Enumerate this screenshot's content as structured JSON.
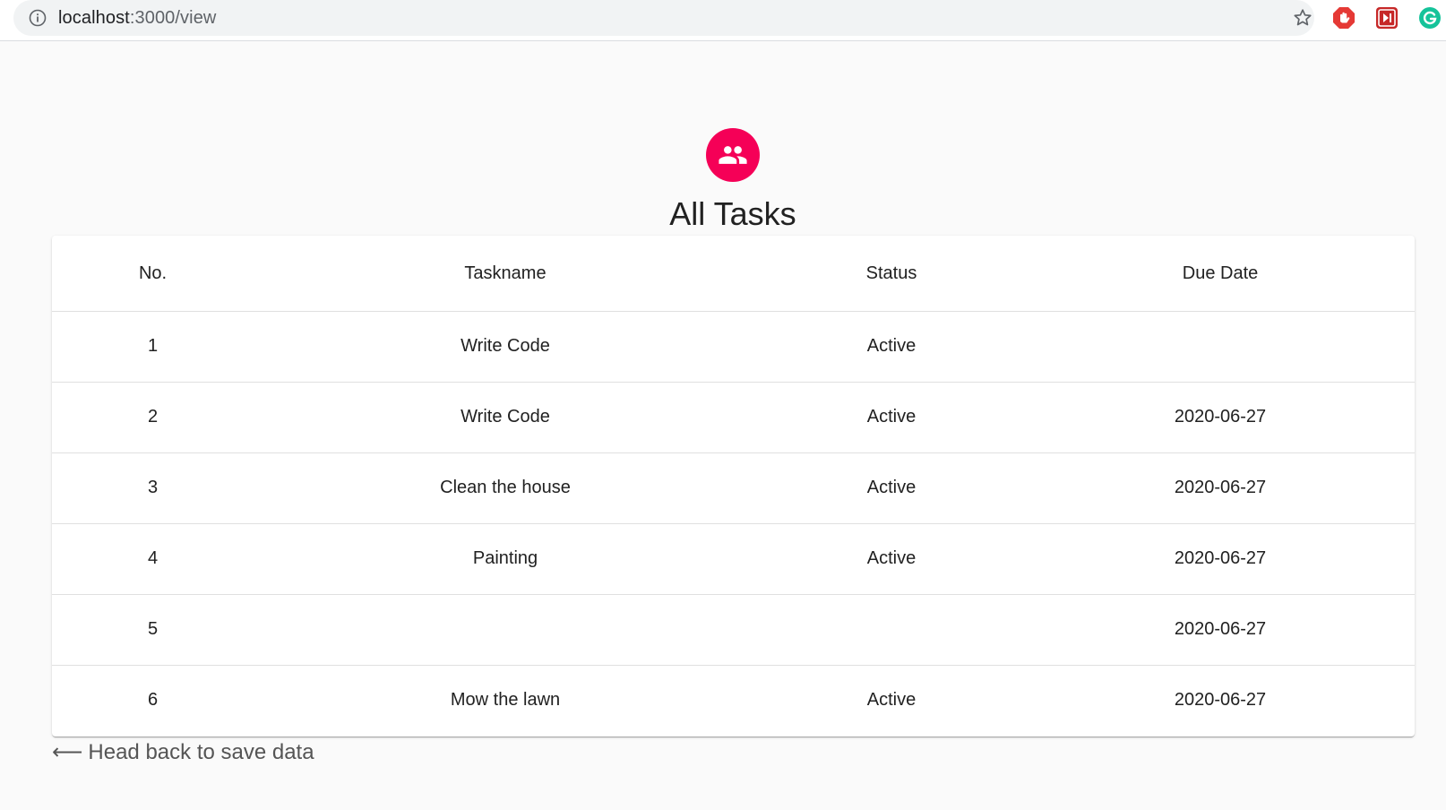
{
  "browser": {
    "url_host": "localhost",
    "url_path": ":3000/view",
    "icons": [
      "info-icon",
      "star-icon",
      "adblock-extension-icon",
      "video-extension-icon",
      "grammarly-extension-icon"
    ]
  },
  "header": {
    "avatar_icon": "people-icon",
    "avatar_color": "#f50057",
    "title": "All Tasks"
  },
  "table": {
    "columns": [
      "No.",
      "Taskname",
      "Status",
      "Due Date"
    ],
    "rows": [
      {
        "no": "1",
        "taskname": "Write Code",
        "status": "Active",
        "due": ""
      },
      {
        "no": "2",
        "taskname": "Write Code",
        "status": "Active",
        "due": "2020-06-27"
      },
      {
        "no": "3",
        "taskname": "Clean the house",
        "status": "Active",
        "due": "2020-06-27"
      },
      {
        "no": "4",
        "taskname": "Painting",
        "status": "Active",
        "due": "2020-06-27"
      },
      {
        "no": "5",
        "taskname": "",
        "status": "",
        "due": "2020-06-27"
      },
      {
        "no": "6",
        "taskname": "Mow the lawn",
        "status": "Active",
        "due": "2020-06-27"
      }
    ]
  },
  "footer": {
    "back_arrow": "⟵",
    "back_label": "Head back to save data"
  }
}
